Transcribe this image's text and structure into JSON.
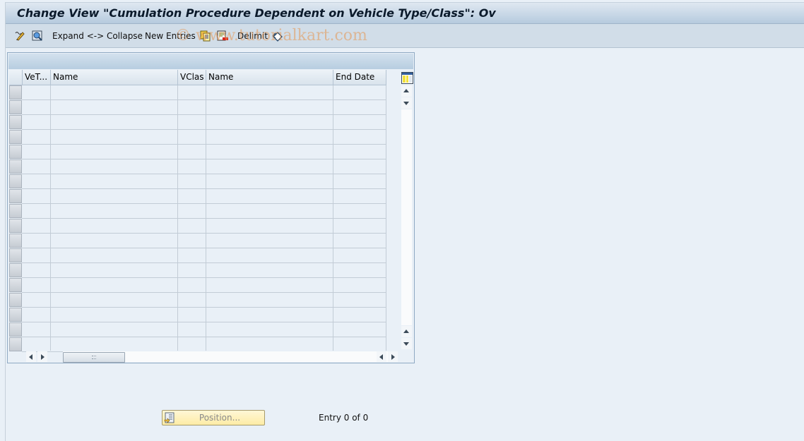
{
  "window": {
    "title": "Change View \"Cumulation Procedure Dependent on Vehicle Type/Class\": Ov"
  },
  "toolbar": {
    "items": [
      {
        "icon": "edit-icon",
        "label": ""
      },
      {
        "icon": "display-icon",
        "label": ""
      },
      {
        "label": "Expand <-> Collapse"
      },
      {
        "label": "New Entries"
      },
      {
        "icon": "copy-icon",
        "label": ""
      },
      {
        "icon": "delete-icon",
        "label": ""
      },
      {
        "label": "Delimit"
      },
      {
        "icon": "undo-change-icon",
        "label": ""
      }
    ],
    "watermark": "© www.tutorialkart.com"
  },
  "table": {
    "columns": [
      "VeT...",
      "Name",
      "VClas",
      "Name",
      "End Date"
    ],
    "rows": [
      [
        "",
        "",
        "",
        "",
        ""
      ],
      [
        "",
        "",
        "",
        "",
        ""
      ],
      [
        "",
        "",
        "",
        "",
        ""
      ],
      [
        "",
        "",
        "",
        "",
        ""
      ],
      [
        "",
        "",
        "",
        "",
        ""
      ],
      [
        "",
        "",
        "",
        "",
        ""
      ],
      [
        "",
        "",
        "",
        "",
        ""
      ],
      [
        "",
        "",
        "",
        "",
        ""
      ],
      [
        "",
        "",
        "",
        "",
        ""
      ],
      [
        "",
        "",
        "",
        "",
        ""
      ],
      [
        "",
        "",
        "",
        "",
        ""
      ],
      [
        "",
        "",
        "",
        "",
        ""
      ],
      [
        "",
        "",
        "",
        "",
        ""
      ],
      [
        "",
        "",
        "",
        "",
        ""
      ],
      [
        "",
        "",
        "",
        "",
        ""
      ],
      [
        "",
        "",
        "",
        "",
        ""
      ],
      [
        "",
        "",
        "",
        "",
        ""
      ],
      [
        "",
        "",
        "",
        "",
        ""
      ]
    ],
    "column_settings_icon": "table-settings-icon"
  },
  "footer": {
    "position_button": "Position...",
    "entry_text": "Entry 0 of 0"
  }
}
